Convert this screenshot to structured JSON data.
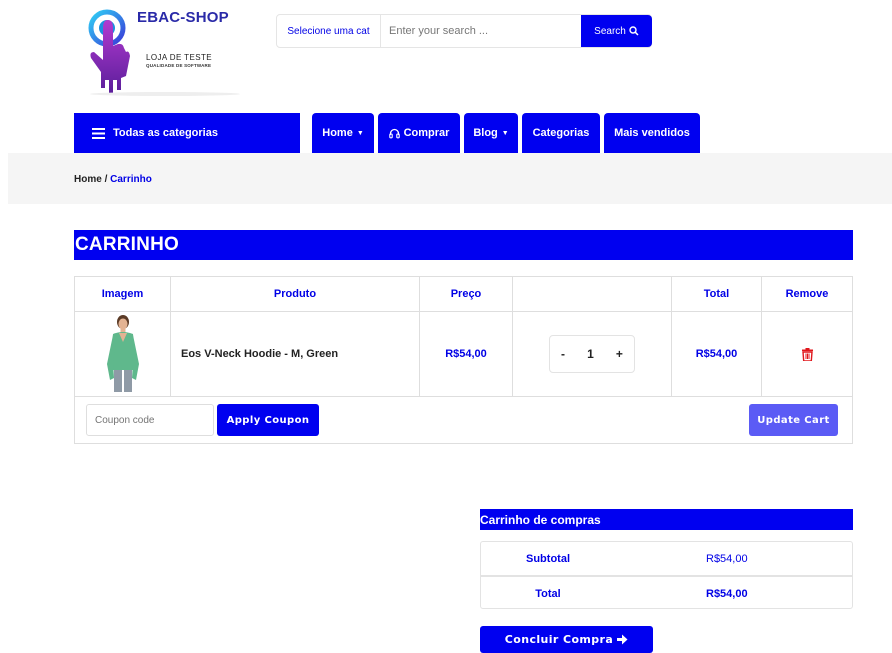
{
  "brand": {
    "name": "EBAC-SHOP",
    "subtitle": "LOJA DE TESTE",
    "tagline": "QUALIDADE DE SOFTWARE"
  },
  "search": {
    "category": "Selecione uma cat",
    "placeholder": "Enter your search ...",
    "button_label": "Search"
  },
  "nav": {
    "all_categories": "Todas as categorias",
    "items": [
      "Home",
      "Comprar",
      "Blog",
      "Categorias",
      "Mais vendidos"
    ]
  },
  "breadcrumb": {
    "home": "Home",
    "separator": " / ",
    "current": "Carrinho"
  },
  "cart": {
    "heading": "CARRINHO",
    "columns": [
      "Imagem",
      "Produto",
      "Preço",
      "",
      "Total",
      "Remove"
    ],
    "items": [
      {
        "product": "Eos V-Neck Hoodie - M, Green",
        "price": "R$54,00",
        "quantity": "1",
        "total": "R$54,00"
      }
    ],
    "minus": "-",
    "plus": "+",
    "coupon_placeholder": "Coupon code",
    "apply_label": "Apply Coupon",
    "update_label": "Update Cart"
  },
  "totals": {
    "heading": "Carrinho de compras",
    "subtotal_label": "Subtotal",
    "subtotal_value": "R$54,00",
    "total_label": "Total",
    "total_value": "R$54,00",
    "checkout_label": "Concluir Compra"
  },
  "colors": {
    "primary": "#0000f0",
    "update_button": "#5b5bf5",
    "remove_icon": "#e0161b"
  }
}
